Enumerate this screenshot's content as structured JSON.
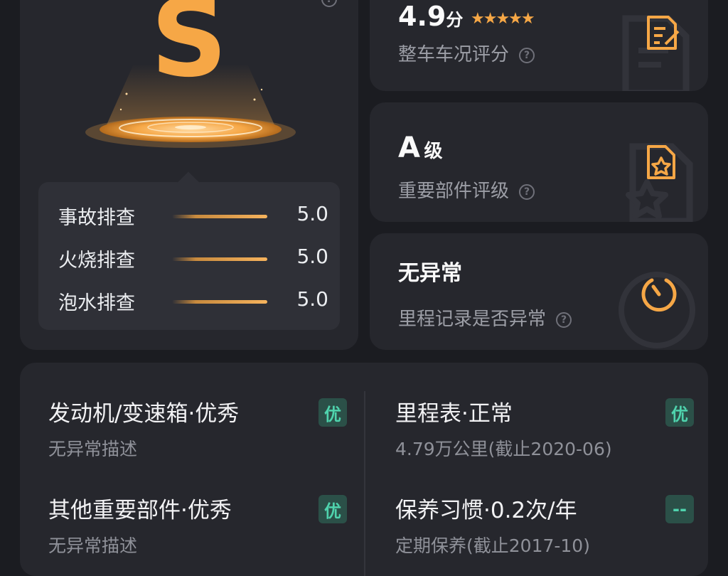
{
  "grade": {
    "letter": "S",
    "scores": [
      {
        "label": "事故排查",
        "value": "5.0",
        "fill": 1.0
      },
      {
        "label": "火烧排查",
        "value": "5.0",
        "fill": 1.0
      },
      {
        "label": "泡水排查",
        "value": "5.0",
        "fill": 1.0
      }
    ]
  },
  "overall": {
    "value": "4.9",
    "unit": "分",
    "stars": "★★★★★",
    "star_count": 5,
    "label": "整车车况评分"
  },
  "parts": {
    "value": "A",
    "unit": "级",
    "label": "重要部件评级"
  },
  "mileage": {
    "value": "无异常",
    "label": "里程记录是否异常"
  },
  "details": [
    {
      "title": "发动机/变速箱·优秀",
      "desc": "无异常描述",
      "badge": "优"
    },
    {
      "title": "里程表·正常",
      "desc": "4.79万公里(截止2020-06)",
      "badge": "优"
    },
    {
      "title": "其他重要部件·优秀",
      "desc": "无异常描述",
      "badge": "优"
    },
    {
      "title": "保养习惯·0.2次/年",
      "desc": "定期保养(截止2017-10)",
      "badge": "--"
    }
  ],
  "help_symbol": "?",
  "colors": {
    "accent": "#f6a746",
    "badge_bg": "#2b5048",
    "badge_text": "#4fd3ad",
    "background": "#1b1c21",
    "card": "#26272d"
  }
}
